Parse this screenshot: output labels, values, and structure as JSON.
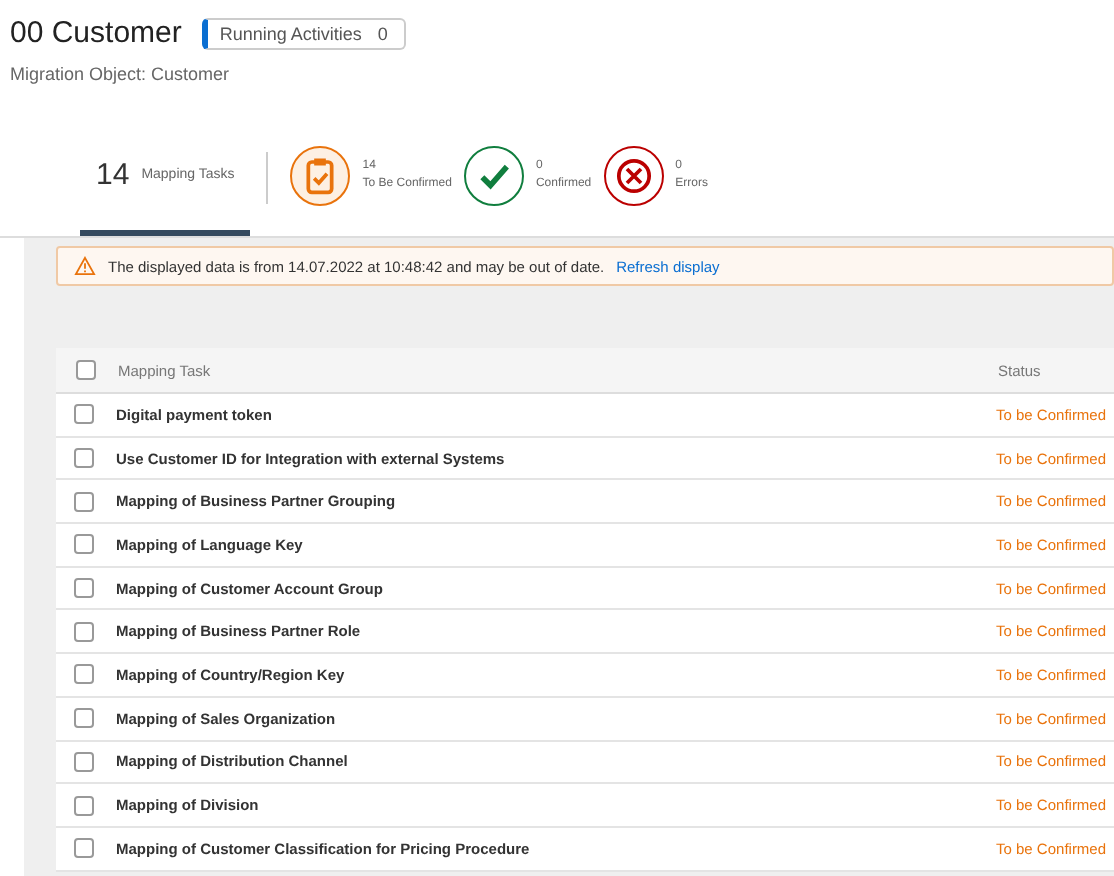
{
  "header": {
    "title": "00 Customer",
    "badge": {
      "label": "Running Activities",
      "count": "0"
    },
    "subtitle": "Migration Object: Customer"
  },
  "tabs": [
    {
      "kind": "count",
      "count": "14",
      "label": "Mapping Tasks",
      "selected": true
    },
    {
      "kind": "clipboard",
      "count": "14",
      "label": "To Be Confirmed",
      "selected": false
    },
    {
      "kind": "check",
      "count": "0",
      "label": "Confirmed",
      "selected": false
    },
    {
      "kind": "error",
      "count": "0",
      "label": "Errors",
      "selected": false
    }
  ],
  "message": {
    "text": "The displayed data is from 14.07.2022 at 10:48:42 and may be out of date.",
    "link": "Refresh display"
  },
  "table": {
    "columns": [
      "Mapping Task",
      "Status"
    ],
    "header_checked": false,
    "rows": [
      {
        "task": "Digital payment token",
        "status": "To be Confirmed",
        "checked": false
      },
      {
        "task": "Use Customer ID for Integration with external Systems",
        "status": "To be Confirmed",
        "checked": false
      },
      {
        "task": "Mapping of Business Partner Grouping",
        "status": "To be Confirmed",
        "checked": false
      },
      {
        "task": "Mapping of Language Key",
        "status": "To be Confirmed",
        "checked": false
      },
      {
        "task": "Mapping of Customer Account Group",
        "status": "To be Confirmed",
        "checked": false
      },
      {
        "task": "Mapping of Business Partner Role",
        "status": "To be Confirmed",
        "checked": false
      },
      {
        "task": "Mapping of Country/Region Key",
        "status": "To be Confirmed",
        "checked": false
      },
      {
        "task": "Mapping of Sales Organization",
        "status": "To be Confirmed",
        "checked": false
      },
      {
        "task": "Mapping of Distribution Channel",
        "status": "To be Confirmed",
        "checked": false
      },
      {
        "task": "Mapping of Division",
        "status": "To be Confirmed",
        "checked": false
      },
      {
        "task": "Mapping of Customer Classification for Pricing Procedure",
        "status": "To be Confirmed",
        "checked": false
      }
    ]
  }
}
